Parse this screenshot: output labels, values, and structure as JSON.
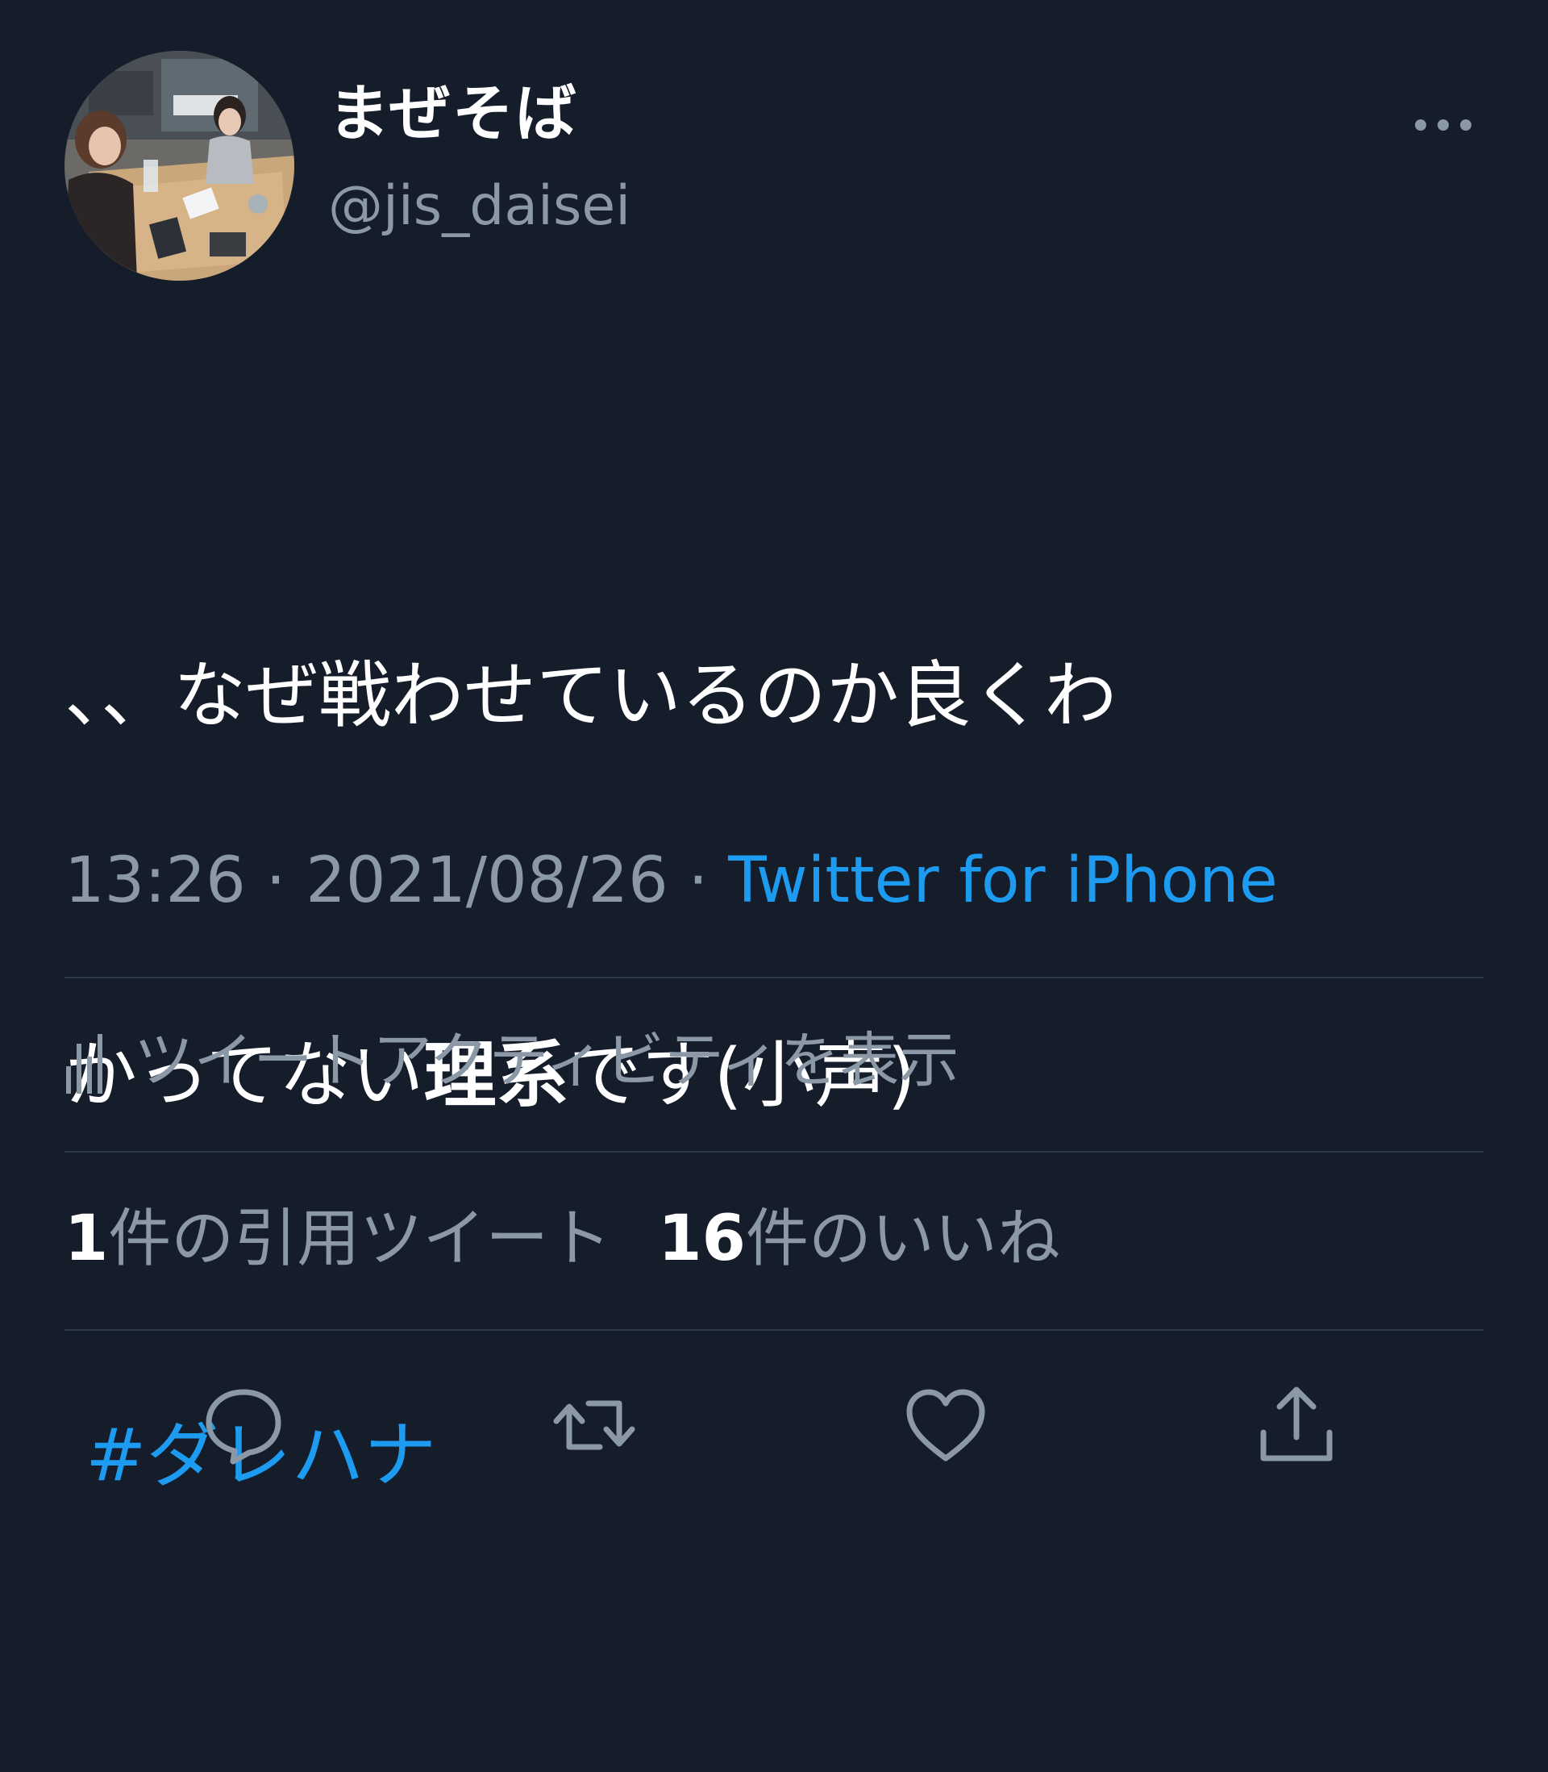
{
  "user": {
    "display_name": "まぜそば",
    "handle": "@jis_daisei",
    "avatar": "avatar-photo"
  },
  "header": {
    "more_icon": "more-horizontal-icon"
  },
  "tweet": {
    "line1": "、、なぜ戦わせているのか良くわ",
    "line2_prefix": "かってない",
    "line2_bold": "理系",
    "line2_suffix": "です(小声)",
    "hashtag": "#ダレハナ"
  },
  "meta": {
    "time": "13:26",
    "separator1": " · ",
    "date": "2021/08/26",
    "separator2": " · ",
    "source": "Twitter for iPhone"
  },
  "activity": {
    "icon": "bar-chart-icon",
    "label": "ツイートアクティビティを表示"
  },
  "stats": {
    "quote_count": "1",
    "quote_label": "件の引用ツイート",
    "like_count": "16",
    "like_label": "件のいいね"
  },
  "actions": [
    {
      "name": "reply",
      "icon": "reply-icon"
    },
    {
      "name": "retweet",
      "icon": "retweet-icon"
    },
    {
      "name": "like",
      "icon": "heart-icon"
    },
    {
      "name": "share",
      "icon": "share-icon"
    }
  ],
  "colors": {
    "background": "#151c2a",
    "text_primary": "#ffffff",
    "text_secondary": "#8b98a5",
    "link": "#1d9bf0",
    "divider": "#2f3a48"
  }
}
